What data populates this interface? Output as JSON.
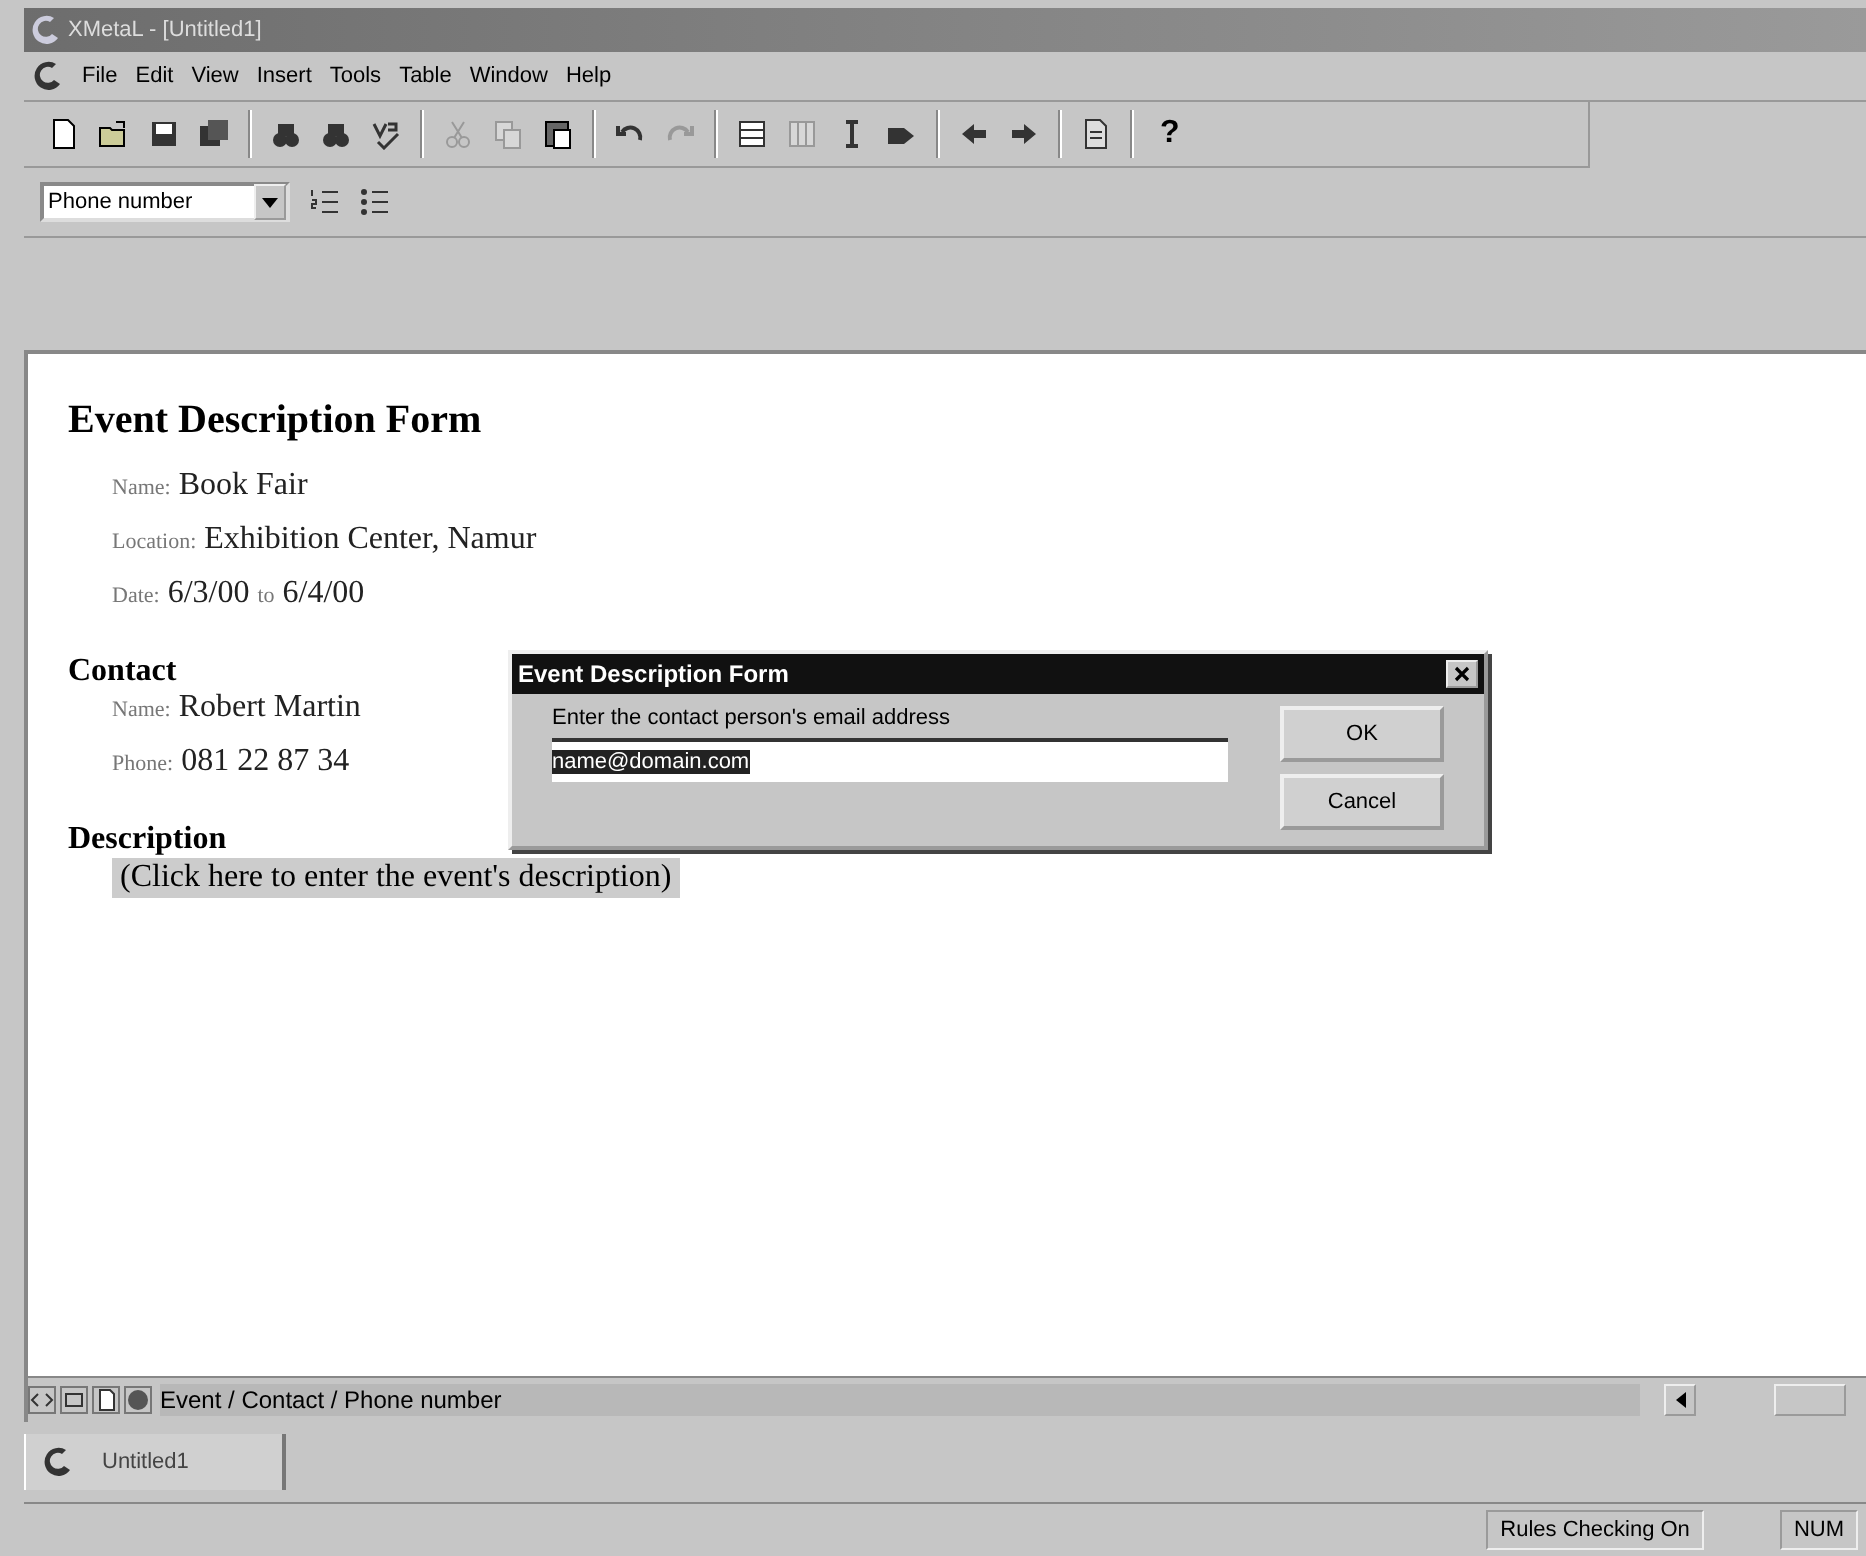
{
  "window": {
    "title": "XMetaL - [Untitled1]"
  },
  "menu": [
    "File",
    "Edit",
    "View",
    "Insert",
    "Tools",
    "Table",
    "Window",
    "Help"
  ],
  "toolbar": [
    [
      {
        "kind": "new",
        "disabled": false
      },
      {
        "kind": "open",
        "disabled": false
      },
      {
        "kind": "save",
        "disabled": false
      },
      {
        "kind": "save-all",
        "disabled": false
      }
    ],
    [
      {
        "kind": "find",
        "disabled": false
      },
      {
        "kind": "replace",
        "disabled": false
      },
      {
        "kind": "spell",
        "disabled": false
      }
    ],
    [
      {
        "kind": "cut",
        "disabled": true
      },
      {
        "kind": "copy",
        "disabled": true
      },
      {
        "kind": "paste",
        "disabled": false
      }
    ],
    [
      {
        "kind": "undo",
        "disabled": false
      },
      {
        "kind": "redo",
        "disabled": true
      }
    ],
    [
      {
        "kind": "table",
        "disabled": false
      },
      {
        "kind": "columns",
        "disabled": true
      },
      {
        "kind": "cursor",
        "disabled": false
      },
      {
        "kind": "tag",
        "disabled": false
      }
    ],
    [
      {
        "kind": "back",
        "disabled": false
      },
      {
        "kind": "forward",
        "disabled": false
      }
    ],
    [
      {
        "kind": "document",
        "disabled": false
      }
    ],
    [
      {
        "kind": "help",
        "label": "?",
        "disabled": false
      }
    ]
  ],
  "element_select": {
    "value": "Phone number"
  },
  "document": {
    "title": "Event Description Form",
    "fields": [
      {
        "label": "Name:",
        "value": "Book Fair"
      },
      {
        "label": "Location:",
        "value": "Exhibition Center, Namur"
      }
    ],
    "date": {
      "label": "Date:",
      "from": "6/3/00",
      "to_label": "to",
      "to": "6/4/00"
    },
    "contact": {
      "heading": "Contact",
      "fields": [
        {
          "label": "Name:",
          "value": "Robert Martin"
        },
        {
          "label": "Phone:",
          "value": "081 22 87 34"
        }
      ]
    },
    "description": {
      "heading": "Description",
      "placeholder": "(Click here to enter the event's description)"
    }
  },
  "dialog": {
    "title": "Event Description Form",
    "prompt": "Enter the contact person's email address",
    "value": "name@domain.com",
    "buttons": [
      "OK",
      "Cancel"
    ]
  },
  "breadcrumb": "Event / Contact / Phone number",
  "tabs": [
    {
      "label": "Untitled1",
      "selected": true
    }
  ],
  "status_bar": [
    "Rules Checking On",
    "NUM"
  ]
}
